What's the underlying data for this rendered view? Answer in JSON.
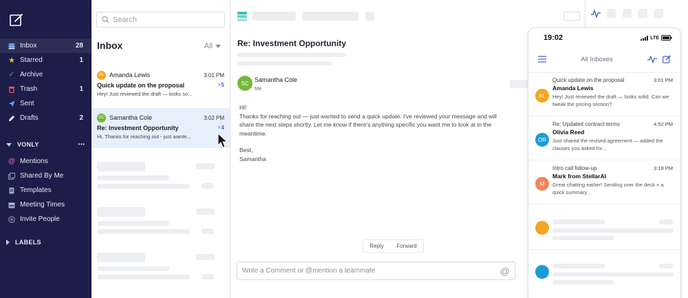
{
  "sidebar": {
    "items": [
      {
        "label": "Inbox",
        "count": "28",
        "icon": "inbox-icon",
        "color": "#6fa8ff"
      },
      {
        "label": "Starred",
        "count": "1",
        "icon": "star-icon",
        "color": "#f5c518"
      },
      {
        "label": "Archive",
        "count": "",
        "icon": "check-icon",
        "color": "#38c172"
      },
      {
        "label": "Trash",
        "count": "1",
        "icon": "trash-icon",
        "color": "#ef5b6d"
      },
      {
        "label": "Sent",
        "count": "",
        "icon": "send-icon",
        "color": "#5aa9f5"
      },
      {
        "label": "Drafts",
        "count": "2",
        "icon": "pencil-icon",
        "color": "#ffffff"
      }
    ],
    "team_section": "VONLY",
    "team_items": [
      {
        "label": "Mentions",
        "icon": "at-icon",
        "color": "#e35bd2"
      },
      {
        "label": "Shared By Me",
        "icon": "shared-icon",
        "color": "#9aa3c7"
      },
      {
        "label": "Templates",
        "icon": "template-icon",
        "color": "#9aa3c7"
      },
      {
        "label": "Meeting Times",
        "icon": "calendar-icon",
        "color": "#9aa3c7"
      },
      {
        "label": "Invite People",
        "icon": "plus-circle-icon",
        "color": "#9aa3c7"
      }
    ],
    "labels_section": "LABELS",
    "more": "•••"
  },
  "list": {
    "search_placeholder": "Search",
    "title": "Inbox",
    "filter": "All",
    "messages": [
      {
        "initials": "AL",
        "avatar_color": "#f5a623",
        "from": "Amanda Lewis",
        "time": "3:01 PM",
        "subject": "Quick update on the proposal",
        "thread": "⚡5",
        "preview": "Hey! Just reviewed the draft — looks so..."
      },
      {
        "initials": "SC",
        "avatar_color": "#74b83a",
        "from": "Samantha Cole",
        "time": "3:02 PM",
        "subject": "Re: Investment Opportunity",
        "thread": "⚡4",
        "preview": "Hi, Thanks for reaching out - just wante..."
      }
    ]
  },
  "detail": {
    "subject": "Re: Investment  Opportunity",
    "sender_initials": "SC",
    "sender_name": "Samantha Cole",
    "sender_to": "Me",
    "greeting": "Hi!",
    "body": "Thanks for reaching out — just wanted to send a quick update. I've reviewed your message and will share the next steps shortly. Let me know if there's anything specific you want me to look at in the meantime.",
    "signoff": "Best,",
    "signature": "Samantha",
    "reply_label": "Reply",
    "forward_label": "Forward",
    "comment_placeholder": "Write a Comment or @mention a teammate",
    "comment_at": "@"
  },
  "phone": {
    "time": "19:02",
    "network": "LTE",
    "title": "All Inboxes",
    "messages": [
      {
        "initials": "AL",
        "avatar_color": "#f5a623",
        "subject": "Quick update on the proposal",
        "time": "3:01 PM",
        "from": "Amanda Lewis",
        "preview": "Hey! Just reviewed the draft — looks solid. Can we tweak the pricing section?"
      },
      {
        "initials": "OR",
        "avatar_color": "#1e9bd7",
        "subject": "Re: Updated contract terms",
        "time": "4:52 PM",
        "from": "Olivia Reed",
        "preview": "Just shared the revised agreement — added the clauses you asked for..."
      },
      {
        "initials": "M",
        "avatar_color": "#f0845a",
        "subject": "Intro call follow-up",
        "time": "3:19 PM",
        "from": "Mark from StellarAI",
        "preview": "Great chatting earlier! Sending over the deck + a quick summary..."
      }
    ],
    "placeholder_avatar_colors": [
      "#f5a623",
      "#1e9bd7"
    ]
  }
}
